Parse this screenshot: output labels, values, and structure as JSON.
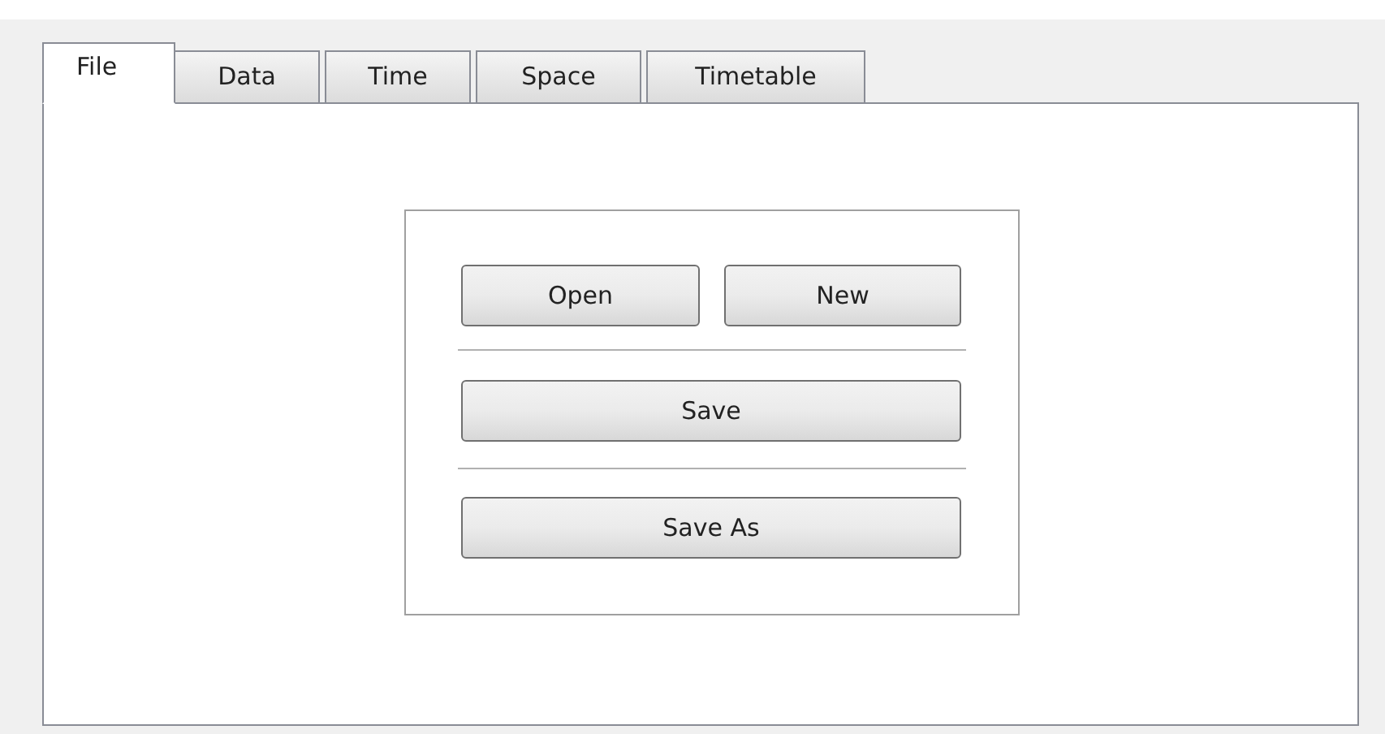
{
  "tabs": [
    {
      "label": "File",
      "selected": true
    },
    {
      "label": "Data",
      "selected": false
    },
    {
      "label": "Time",
      "selected": false
    },
    {
      "label": "Space",
      "selected": false
    },
    {
      "label": "Timetable",
      "selected": false
    }
  ],
  "buttons": {
    "open": "Open",
    "new": "New",
    "save": "Save",
    "save_as": "Save As"
  }
}
